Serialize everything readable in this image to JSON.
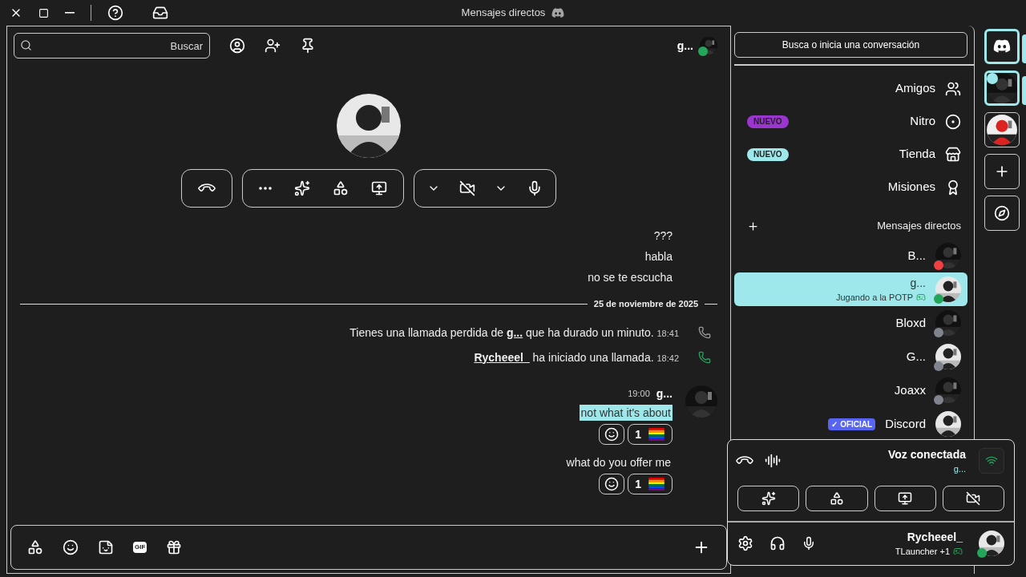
{
  "window": {
    "title": "Mensajes directos"
  },
  "chat_header": {
    "name": "g...",
    "presence": {
      "color": "#23a55a"
    },
    "search": {
      "placeholder": "Buscar"
    }
  },
  "call": {
    "mic_on": true,
    "camera_on": false
  },
  "messages": [
    {
      "kind": "text",
      "text": "???"
    },
    {
      "kind": "text",
      "text": "habla"
    },
    {
      "kind": "text",
      "text": "no se te escucha"
    },
    {
      "kind": "divider",
      "text": "25 de noviembre de 2025"
    },
    {
      "kind": "call",
      "missed": true,
      "before": "Tienes una llamada perdida de ",
      "user": "g...",
      "after": " que ha durado un minuto.",
      "time": "18:41"
    },
    {
      "kind": "call",
      "missed": false,
      "user": "Rycheeel_",
      "after": " ha iniciado una llamada.",
      "time": "18:42"
    },
    {
      "kind": "group",
      "author": "g...",
      "time": "19:00",
      "lines": [
        {
          "text": "not what it's about",
          "highlighted": true,
          "reactions": [
            {
              "count": "1"
            }
          ]
        },
        {
          "text": "what do you offer me",
          "highlighted": false,
          "reactions": [
            {
              "count": "1"
            }
          ]
        }
      ]
    }
  ],
  "composer": {
    "gif_label": "GIF"
  },
  "sidebar": {
    "search_button": "Busca o inicia una conversación",
    "nav": [
      {
        "label": "Amigos"
      },
      {
        "label": "Nitro",
        "badge": {
          "text": "NUEVO",
          "color": "#9b35d0"
        }
      },
      {
        "label": "Tienda",
        "badge": {
          "text": "NUEVO",
          "color": "#9ee8ec"
        }
      },
      {
        "label": "Misiones"
      }
    ],
    "dm_header": "Mensajes directos",
    "dms": [
      {
        "name": "B...",
        "presence": {
          "color": "#f23f43"
        },
        "selected": false
      },
      {
        "name": "g...",
        "activity": "Jugando a la POTP",
        "presence": {
          "color": "#23a55a"
        },
        "selected": true
      },
      {
        "name": "Bloxd",
        "presence": {
          "color": "#80848e"
        },
        "selected": false
      },
      {
        "name": "G...",
        "presence": {
          "color": "#80848e"
        },
        "selected": false
      },
      {
        "name": "Joaxx",
        "presence": {
          "color": "#80848e"
        },
        "selected": false
      },
      {
        "name": "Discord",
        "badge": "✓ OFICIAL",
        "selected": false
      }
    ]
  },
  "voice": {
    "title": "Voz conectada",
    "channel": "g...",
    "camera_on": false
  },
  "user": {
    "name": "Rycheeel_",
    "activity": "TLauncher +1",
    "presence": {
      "color": "#23a55a"
    },
    "mic_on": true
  },
  "servers": [
    {
      "kind": "home",
      "selected": true
    },
    {
      "kind": "picture",
      "selected": true,
      "speaking": true
    },
    {
      "kind": "picture",
      "selected": false,
      "speaking": false
    },
    {
      "kind": "add"
    },
    {
      "kind": "discover"
    }
  ]
}
